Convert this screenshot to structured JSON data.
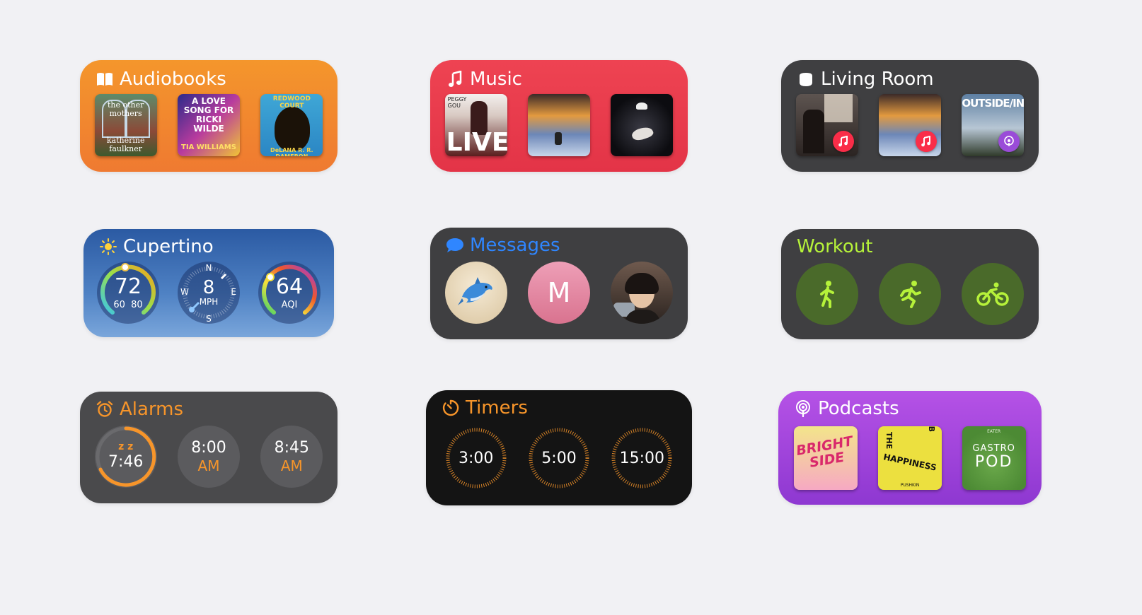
{
  "audiobooks": {
    "title": "Audiobooks",
    "accent": "#f28a2e",
    "books": [
      {
        "title": "the other mothers",
        "author": "katherine faulkner"
      },
      {
        "title": "A LOVE SONG FOR RICKI WILDE",
        "author": "TIA WILLIAMS"
      },
      {
        "title": "REDWOOD COURT",
        "author": "DeLANA R. R. DAMERON"
      }
    ]
  },
  "music": {
    "title": "Music",
    "accent": "#e83c4d",
    "albums": [
      {
        "line1": "PEGGY",
        "line2": "GOU",
        "big": "LIVE"
      },
      {
        "line1": "",
        "line2": "",
        "big": ""
      },
      {
        "line1": "",
        "line2": "",
        "big": ""
      }
    ]
  },
  "living_room": {
    "title": "Living Room",
    "items": [
      {
        "badge": "music-icon",
        "label": ""
      },
      {
        "badge": "music-icon",
        "label": ""
      },
      {
        "badge": "podcast-icon",
        "label": "OUTSIDE/IN"
      }
    ]
  },
  "weather": {
    "title": "Cupertino",
    "temp": "72",
    "low": "60",
    "high": "80",
    "wind_speed": "8",
    "wind_unit": "MPH",
    "dir_n": "N",
    "dir_s": "S",
    "dir_e": "E",
    "dir_w": "W",
    "aqi_value": "64",
    "aqi_label": "AQI"
  },
  "messages": {
    "title": "Messages",
    "accent": "#2f86ff",
    "contacts": [
      {
        "kind": "dolphin",
        "initial": ""
      },
      {
        "kind": "initial",
        "initial": "M"
      },
      {
        "kind": "photo",
        "initial": ""
      }
    ]
  },
  "workout": {
    "title": "Workout",
    "accent": "#b6f23a",
    "activities": [
      "outdoor-walk-icon",
      "outdoor-run-icon",
      "outdoor-cycle-icon"
    ]
  },
  "alarms": {
    "title": "Alarms",
    "accent": "#f7952a",
    "snooze": "z z",
    "items": [
      {
        "time": "7:46",
        "ampm": ""
      },
      {
        "time": "8:00",
        "ampm": "AM"
      },
      {
        "time": "8:45",
        "ampm": "AM"
      }
    ]
  },
  "timers": {
    "title": "Timers",
    "accent": "#f7952a",
    "items": [
      "3:00",
      "5:00",
      "15:00"
    ]
  },
  "podcasts": {
    "title": "Podcasts",
    "accent": "#a94be0",
    "shows": [
      {
        "line1": "BRIGHT",
        "line2": "SIDE",
        "corner": ""
      },
      {
        "line1": "THE",
        "line2": "HAPPINESS",
        "corner": "LAB",
        "footer": "PUSHKIN"
      },
      {
        "line1": "GASTRO",
        "line2": "POD",
        "corner": "EATER"
      }
    ]
  }
}
